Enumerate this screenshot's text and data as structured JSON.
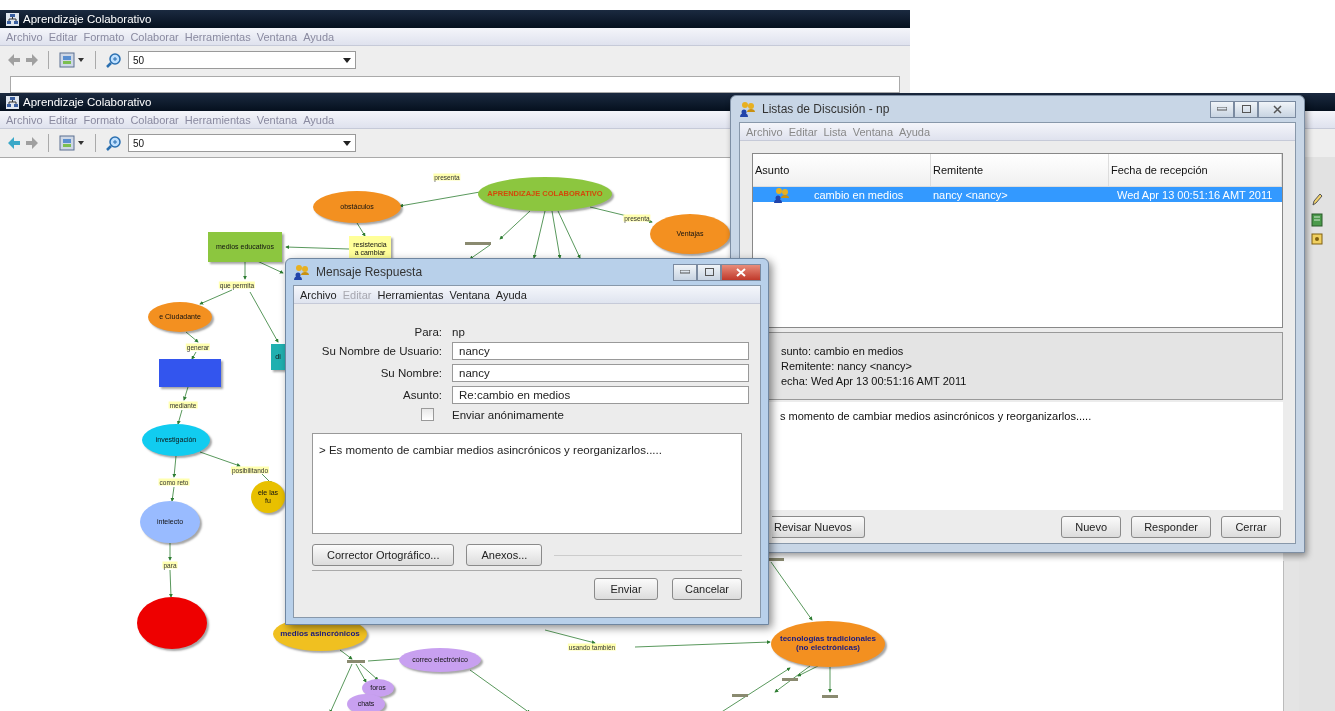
{
  "back_window": {
    "title": "Aprendizaje Colaborativo",
    "active": false,
    "menu": [
      "Archivo",
      "Editar",
      "Formato",
      "Colaborar",
      "Herramientas",
      "Ventana",
      "Ayuda"
    ],
    "back_enabled": false,
    "zoom": "50"
  },
  "main_window": {
    "title": "Aprendizaje Colaborativo",
    "active": false,
    "menu": [
      "Archivo",
      "Editar",
      "Formato",
      "Colaborar",
      "Herramientas",
      "Ventana",
      "Ayuda"
    ],
    "back_enabled": true,
    "zoom": "50",
    "concept_map": {
      "nodes": [
        {
          "label": "APRENDIZAJE COLABORATIVO",
          "kind": "title",
          "color": "#8cc63f"
        },
        {
          "label": "obstáculos",
          "kind": "ellipse",
          "color": "#f39020"
        },
        {
          "label": "Ventajas",
          "kind": "ellipse",
          "color": "#f39020"
        },
        {
          "label": "medios educativos",
          "kind": "box",
          "color": "#8cc63f"
        },
        {
          "label": "resistencia a cambiar",
          "kind": "box",
          "color": "#ffff99"
        },
        {
          "label": "e Ciudadante",
          "kind": "ellipse",
          "color": "#f39020"
        },
        {
          "kind": "box",
          "color": "#3355ee"
        },
        {
          "label": "investigación",
          "kind": "ellipse",
          "color": "#11ccf0"
        },
        {
          "label": "intelecto",
          "kind": "ellipse",
          "color": "#99bbff"
        },
        {
          "kind": "ellipse",
          "color": "#ee0000"
        },
        {
          "label": "di",
          "kind": "box",
          "color": "#20b0b0"
        },
        {
          "label": "ele las fu",
          "kind": "ellipse",
          "color": "#e8c000"
        },
        {
          "label": "medios asincrónicos",
          "kind": "strong",
          "color": "#f0c020"
        },
        {
          "label": "correo electrónico",
          "kind": "ellipse",
          "color": "#c8a0f0"
        },
        {
          "label": "foros",
          "kind": "ellipse",
          "color": "#c8a0f0"
        },
        {
          "label": "chats",
          "kind": "ellipse",
          "color": "#c8a0f0"
        },
        {
          "label": "tecnologías tradicionales (no electrónicas)",
          "kind": "strong",
          "color": "#f39020"
        }
      ],
      "links": [
        "presenta",
        "presenta",
        "que permita",
        "generar",
        "mediante",
        "como reto",
        "posibilitando",
        "para",
        "usando también"
      ]
    }
  },
  "discussion_window": {
    "title": "Listas de Discusión - np",
    "menu": [
      "Archivo",
      "Editar",
      "Lista",
      "Ventana",
      "Ayuda"
    ],
    "columns": [
      "Asunto",
      "Remitente",
      "Fecha de recepción"
    ],
    "rows": [
      {
        "asunto": "cambio en medios",
        "remitente": "nancy <nancy>",
        "fecha": "Wed Apr 13 00:51:16 AMT 2011",
        "selected": true
      }
    ],
    "details": [
      "sunto:  cambio en medios",
      "Remitente:  nancy <nancy>",
      "echa:  Wed Apr 13 00:51:16 AMT 2011"
    ],
    "message": "s momento de cambiar medios asincrónicos y reorganizarlos.....",
    "buttons": [
      "Revisar Nuevos",
      "Nuevo",
      "Responder",
      "Cerrar"
    ]
  },
  "reply_dialog": {
    "title": "Mensaje Respuesta",
    "menu": [
      {
        "label": "Archivo",
        "disabled": false
      },
      {
        "label": "Editar",
        "disabled": true
      },
      {
        "label": "Herramientas",
        "disabled": false
      },
      {
        "label": "Ventana",
        "disabled": false
      },
      {
        "label": "Ayuda",
        "disabled": false
      }
    ],
    "to_label": "Para:",
    "to": "np",
    "fields": [
      {
        "label": "Su Nombre de Usuario:",
        "value": "nancy"
      },
      {
        "label": "Su Nombre:",
        "value": "nancy"
      },
      {
        "label": "Asunto:",
        "value": "Re:cambio en medios"
      }
    ],
    "anonymous": {
      "label": "Enviar anónimamente",
      "checked": false
    },
    "body": "> Es momento de cambiar medios asincrónicos y reorganizarlos.....",
    "tool_buttons": [
      "Corrector Ortográfico...",
      "Anexos..."
    ],
    "buttons": [
      "Enviar",
      "Cancelar"
    ]
  }
}
